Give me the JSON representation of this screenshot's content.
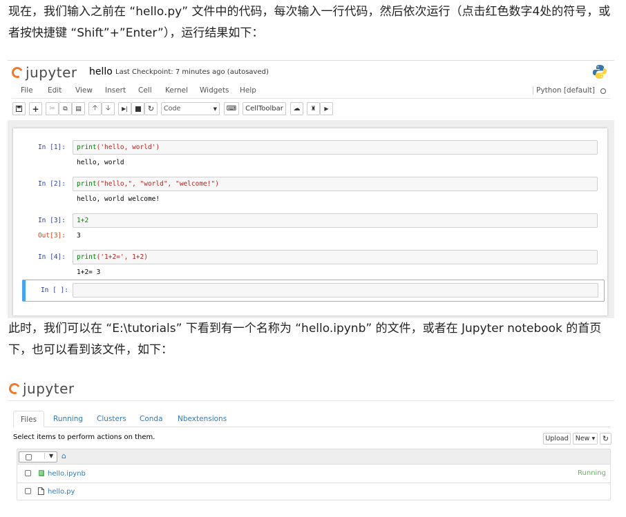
{
  "intro_text": "现在，我们输入之前在 “hello.py” 文件中的代码，每次输入一行代码，然后依次运行（点击红色数字4处的符号，或者按快捷键 “Shift”+”Enter”），运行结果如下：",
  "notebook": {
    "logo_text": "jupyter",
    "name": "hello",
    "checkpoint": "Last Checkpoint: 7 minutes ago (autosaved)",
    "menu": [
      "File",
      "Edit",
      "View",
      "Insert",
      "Cell",
      "Kernel",
      "Widgets",
      "Help"
    ],
    "kernel": "Python [default]",
    "toolbar": {
      "cell_type": "Code",
      "celltoolbar_label": "CellToolbar"
    },
    "cells": [
      {
        "prompt": "In  [1]:",
        "code_print": "print",
        "code_rest": "('hello, world')",
        "output": "hello, world"
      },
      {
        "prompt": "In  [2]:",
        "code_print": "print",
        "code_rest": "(\"hello,\", \"world\", \"welcome!\")",
        "output": "hello, world welcome!"
      },
      {
        "prompt": "In  [3]:",
        "code": "1+2",
        "out_prompt": "Out[3]:",
        "output": "3"
      },
      {
        "prompt": "In  [4]:",
        "code_print": "print",
        "code_rest": "('1+2=', 1+2)",
        "output": "1+2= 3"
      },
      {
        "prompt": "In  [ ]:"
      }
    ]
  },
  "middle_text": "此时，我们可以在 “E:\\tutorials” 下看到有一个名称为 “hello.ipynb” 的文件，或者在 Jupyter notebook 的首页下，也可以看到该文件，如下：",
  "tree": {
    "logo_text": "jupyter",
    "tabs": [
      "Files",
      "Running",
      "Clusters",
      "Conda",
      "Nbextensions"
    ],
    "hint": "Select items to perform actions on them.",
    "upload_label": "Upload",
    "new_label": "New ▾",
    "files": [
      {
        "name": "hello.ipynb",
        "status": "Running"
      },
      {
        "name": "hello.py",
        "status": ""
      }
    ]
  }
}
